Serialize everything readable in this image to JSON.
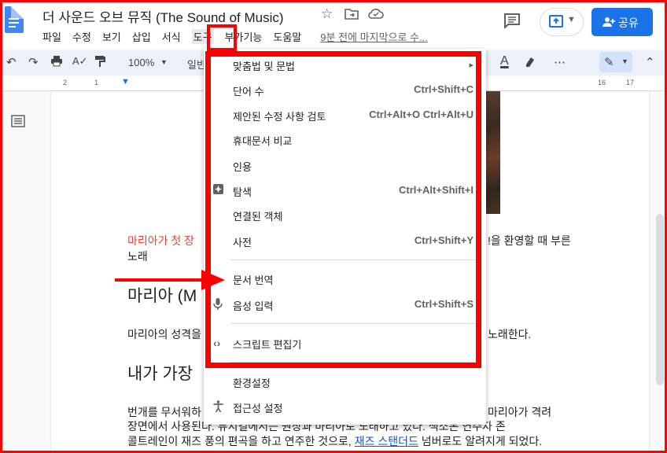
{
  "app": {
    "title": "더 사운드 오브 뮤직 (The Sound of Music)",
    "menus": [
      "파일",
      "수정",
      "보기",
      "삽입",
      "서식",
      "도구",
      "부가기능",
      "도움말"
    ],
    "active_menu": "도구",
    "last_edit": "9분 전에 마지막으로 수...",
    "share_label": "공유"
  },
  "toolbar": {
    "zoom": "100%",
    "style": "일반"
  },
  "ruler": {
    "marks": [
      "2",
      "1",
      "16",
      "17"
    ]
  },
  "dropdown": {
    "items": [
      {
        "label": "맞춤법 및 문법",
        "shortcut": "",
        "icon": "",
        "submenu": "▸"
      },
      {
        "label": "단어 수",
        "shortcut": "Ctrl+Shift+C",
        "icon": ""
      },
      {
        "label": "제안된 수정 사항 검토",
        "shortcut": "Ctrl+Alt+O Ctrl+Alt+U",
        "icon": ""
      },
      {
        "label": "휴대문서 비교",
        "shortcut": "",
        "icon": ""
      },
      {
        "label": "인용",
        "shortcut": "",
        "icon": ""
      },
      {
        "label": "탐색",
        "shortcut": "Ctrl+Alt+Shift+I",
        "icon": "explore-icon"
      },
      {
        "label": "연결된 객체",
        "shortcut": "",
        "icon": ""
      },
      {
        "label": "사전",
        "shortcut": "Ctrl+Shift+Y",
        "icon": ""
      },
      {
        "label": "문서 번역",
        "shortcut": "",
        "icon": ""
      },
      {
        "label": "음성 입력",
        "shortcut": "Ctrl+Shift+S",
        "icon": "microphone-icon"
      },
      {
        "label": "스크립트 편집기",
        "shortcut": "",
        "icon": "code-icon"
      },
      {
        "label": "환경설정",
        "shortcut": "",
        "icon": ""
      },
      {
        "label": "접근성 설정",
        "shortcut": "",
        "icon": "accessibility-icon"
      }
    ]
  },
  "document": {
    "red_text": "마리아가 첫 장",
    "red_text_tail": "!을 환영할 때 부른",
    "red_text_line2": "노래",
    "heading1": "마리아 (M",
    "para1_start": "마리아의 성격을",
    "para1_end": "노래한다.",
    "heading2": "내가 가장",
    "para2_line1_start": "번개를 무서워하",
    "para2_line1_end": "마리아가 격려",
    "para2_line2": "장면에서 사용된다. 뮤지컬에서는 원장과 마리아로 노래하고 있다. 색소폰 연주자 존",
    "para2_line3_start": "콜트레인이 재즈 풍의 편곡을 하고 연주한 것으로,",
    "para2_link": "재즈 스탠더드",
    "para2_line3_end": "넘버로도 알려지게 되었다."
  },
  "colors": {
    "highlight_red": "#ff0000",
    "brand_blue": "#1a73e8",
    "doc_red_text": "#ea4335"
  }
}
